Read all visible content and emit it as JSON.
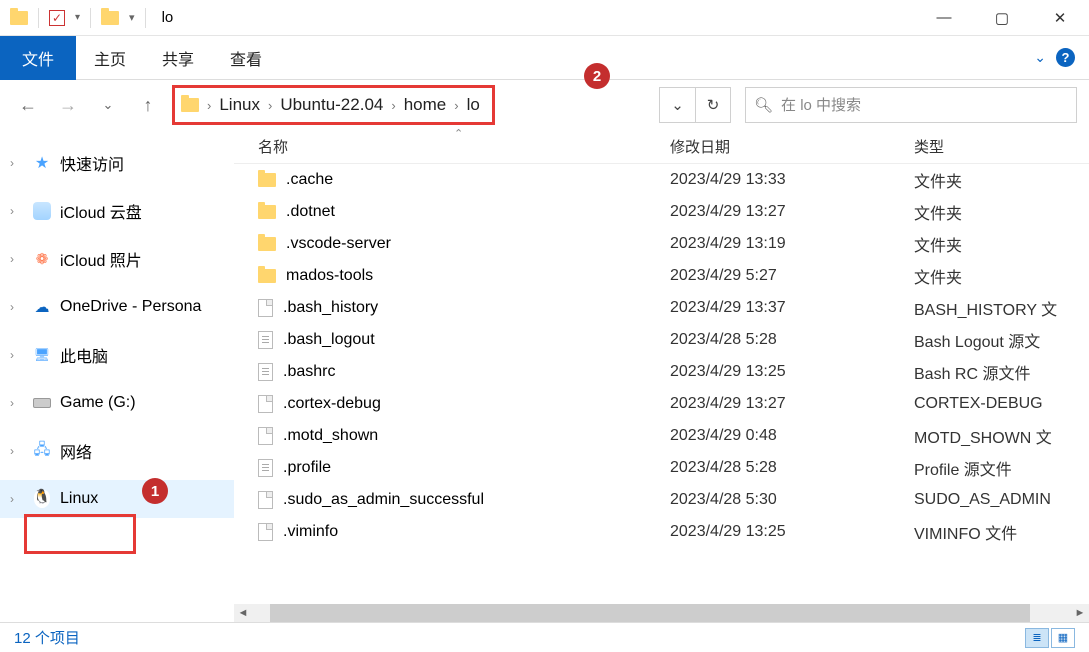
{
  "window": {
    "title": "lo"
  },
  "ribbon": {
    "file": "文件",
    "home": "主页",
    "share": "共享",
    "view": "查看"
  },
  "breadcrumb": [
    "Linux",
    "Ubuntu-22.04",
    "home",
    "lo"
  ],
  "search": {
    "placeholder": "在 lo 中搜索"
  },
  "tree": {
    "quick_access": "快速访问",
    "icloud_drive": "iCloud 云盘",
    "icloud_photos": "iCloud 照片",
    "onedrive": "OneDrive - Persona",
    "this_pc": "此电脑",
    "game_drive": "Game (G:)",
    "network": "网络",
    "linux": "Linux"
  },
  "badges": {
    "one": "1",
    "two": "2"
  },
  "columns": {
    "name": "名称",
    "modified": "修改日期",
    "type": "类型"
  },
  "files": [
    {
      "name": ".cache",
      "date": "2023/4/29 13:33",
      "type": "文件夹",
      "icon": "folder"
    },
    {
      "name": ".dotnet",
      "date": "2023/4/29 13:27",
      "type": "文件夹",
      "icon": "folder"
    },
    {
      "name": ".vscode-server",
      "date": "2023/4/29 13:19",
      "type": "文件夹",
      "icon": "folder"
    },
    {
      "name": "mados-tools",
      "date": "2023/4/29 5:27",
      "type": "文件夹",
      "icon": "folder"
    },
    {
      "name": ".bash_history",
      "date": "2023/4/29 13:37",
      "type": "BASH_HISTORY 文",
      "icon": "file"
    },
    {
      "name": ".bash_logout",
      "date": "2023/4/28 5:28",
      "type": "Bash Logout 源文",
      "icon": "txt"
    },
    {
      "name": ".bashrc",
      "date": "2023/4/29 13:25",
      "type": "Bash RC 源文件",
      "icon": "txt"
    },
    {
      "name": ".cortex-debug",
      "date": "2023/4/29 13:27",
      "type": "CORTEX-DEBUG",
      "icon": "file"
    },
    {
      "name": ".motd_shown",
      "date": "2023/4/29 0:48",
      "type": "MOTD_SHOWN 文",
      "icon": "file"
    },
    {
      "name": ".profile",
      "date": "2023/4/28 5:28",
      "type": "Profile 源文件",
      "icon": "txt"
    },
    {
      "name": ".sudo_as_admin_successful",
      "date": "2023/4/28 5:30",
      "type": "SUDO_AS_ADMIN",
      "icon": "file"
    },
    {
      "name": ".viminfo",
      "date": "2023/4/29 13:25",
      "type": "VIMINFO 文件",
      "icon": "file"
    }
  ],
  "status": {
    "count": "12 个项目"
  }
}
